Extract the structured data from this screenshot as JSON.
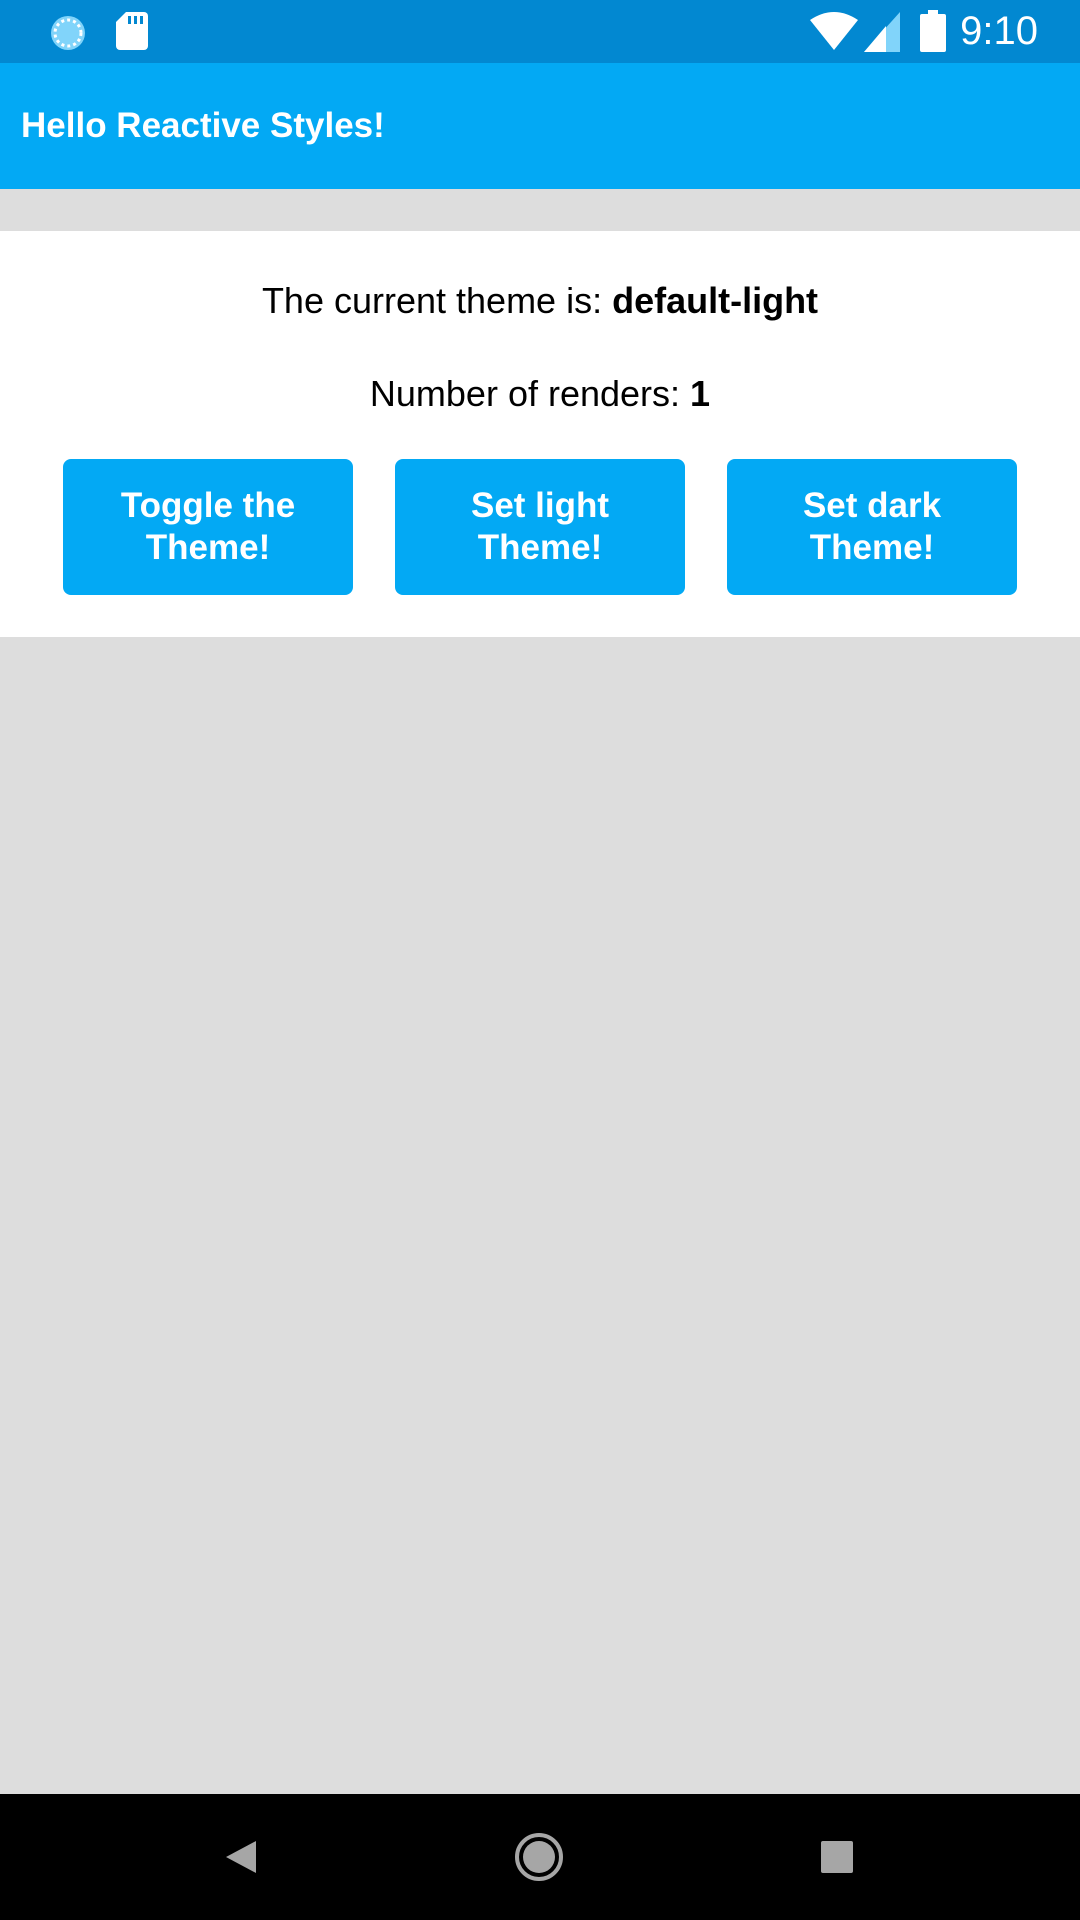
{
  "status_bar": {
    "time": "9:10",
    "icons": [
      "sync-icon",
      "sd-card-icon",
      "wifi-icon",
      "cell-signal-icon",
      "battery-icon"
    ]
  },
  "app_bar": {
    "title": "Hello Reactive Styles!"
  },
  "content": {
    "theme_prefix": "The current theme is: ",
    "theme_value": "default-light",
    "renders_prefix": "Number of renders: ",
    "renders_value": "1"
  },
  "buttons": [
    {
      "label": "Toggle the Theme!"
    },
    {
      "label": "Set light Theme!"
    },
    {
      "label": "Set dark Theme!"
    }
  ],
  "nav_bar": {
    "icons": [
      "back-icon",
      "home-icon",
      "recents-icon"
    ]
  },
  "colors": {
    "status_bar": "#0288d1",
    "app_bar": "#03a9f4",
    "button": "#03a9f4",
    "background": "#dddddd",
    "card": "#ffffff",
    "nav_bar": "#000000"
  }
}
